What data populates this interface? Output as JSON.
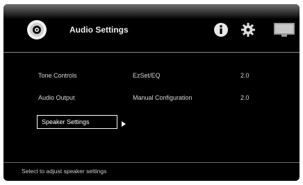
{
  "header": {
    "title": "Audio Settings",
    "icons": [
      "disc-icon",
      "info-icon",
      "gear-icon",
      "tv-icon"
    ]
  },
  "menu": {
    "items": [
      {
        "label": "Tone Controls"
      },
      {
        "label": "Audio Output"
      },
      {
        "label": "Speaker Settings",
        "selected": true
      }
    ]
  },
  "details": {
    "rows": [
      {
        "name": "EzSet/EQ",
        "value": "2.0"
      },
      {
        "name": "Manual Configuration",
        "value": "2.0"
      }
    ]
  },
  "status": {
    "text": "Select to adjust speaker settings"
  }
}
